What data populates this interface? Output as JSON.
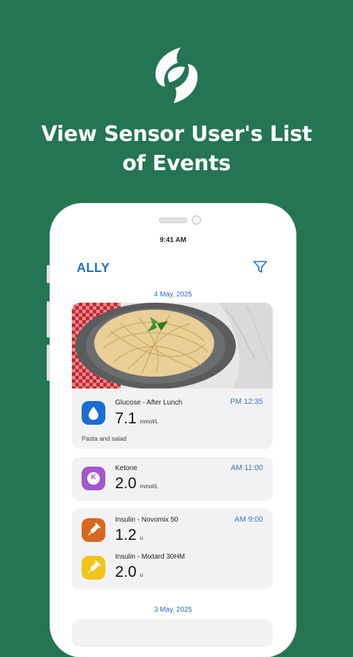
{
  "headline": {
    "line1": "View Sensor User's List",
    "line2": "of Events"
  },
  "status_bar": {
    "time": "9:41 AM"
  },
  "app": {
    "title": "ALLY"
  },
  "icons": {
    "logo": "leaf-logo-icon",
    "filter": "filter-icon",
    "glucose": "drop-icon",
    "ketone": "ketone-k-icon",
    "insulin": "syringe-icon"
  },
  "colors": {
    "background": "#247552",
    "accent": "#1e6fc4",
    "glucose": "#1b6dd1",
    "ketone": "#a257cf",
    "insulin_novomix": "#d8671f",
    "insulin_mixtard": "#f0c419"
  },
  "groups": [
    {
      "date": "4 May, 2025"
    },
    {
      "date": "3 May, 2025"
    }
  ],
  "events": {
    "glucose": {
      "name": "Glucose - After Lunch",
      "time": "PM 12:35",
      "value": "7.1",
      "unit": "mmol/L",
      "note": "Pasta and salad"
    },
    "ketone": {
      "name": "Ketone",
      "time": "AM 11:00",
      "value": "2.0",
      "unit": "mmol/L",
      "icon_letter": "K"
    },
    "insulin_novomix": {
      "name": "Insulin - Novomix 50",
      "time": "AM 9:00",
      "value": "1.2",
      "unit": "u"
    },
    "insulin_mixtard": {
      "name": "Insulin - Mixtard 30HM",
      "value": "2.0",
      "unit": "u"
    }
  }
}
